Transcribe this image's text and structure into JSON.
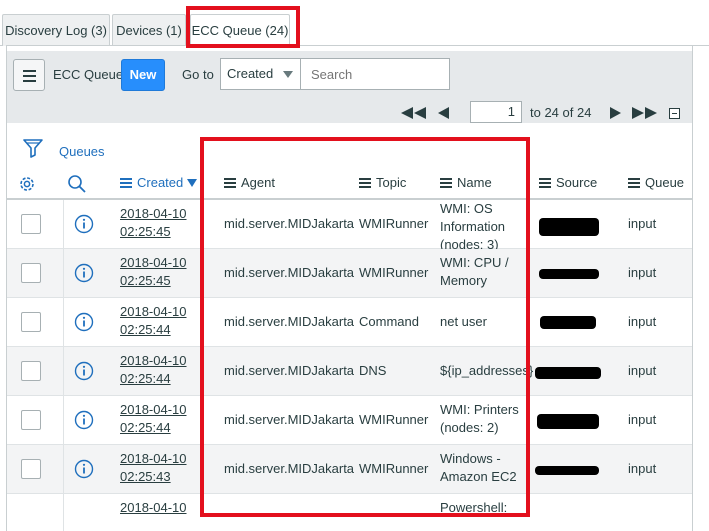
{
  "tabs": [
    {
      "label": "Discovery Log (3)"
    },
    {
      "label": "Devices (1)"
    },
    {
      "label": "ECC Queue (24)"
    }
  ],
  "toolbar": {
    "title": "ECC Queue",
    "new_label": "New",
    "goto_label": "Go to",
    "goto_select_value": "Created",
    "search_placeholder": "Search",
    "pager_current": "1",
    "pager_text": "to 24 of 24"
  },
  "filter": {
    "queues_label": "Queues"
  },
  "columns": {
    "created": "Created",
    "agent": "Agent",
    "topic": "Topic",
    "name": "Name",
    "source": "Source",
    "queue": "Queue"
  },
  "rows": [
    {
      "date": "2018-04-10",
      "time": "02:25:45",
      "agent": "mid.server.MIDJakarta",
      "topic": "WMIRunner",
      "name": "WMI: OS Information (nodes: 3)",
      "queue": "input"
    },
    {
      "date": "2018-04-10",
      "time": "02:25:45",
      "agent": "mid.server.MIDJakarta",
      "topic": "WMIRunner",
      "name": "WMI: CPU / Memory",
      "queue": "input"
    },
    {
      "date": "2018-04-10",
      "time": "02:25:44",
      "agent": "mid.server.MIDJakarta",
      "topic": "Command",
      "name": "net user",
      "queue": "input"
    },
    {
      "date": "2018-04-10",
      "time": "02:25:44",
      "agent": "mid.server.MIDJakarta",
      "topic": "DNS",
      "name": "${ip_addresses}",
      "queue": "input"
    },
    {
      "date": "2018-04-10",
      "time": "02:25:44",
      "agent": "mid.server.MIDJakarta",
      "topic": "WMIRunner",
      "name": "WMI: Printers (nodes: 2)",
      "queue": "input"
    },
    {
      "date": "2018-04-10",
      "time": "02:25:43",
      "agent": "mid.server.MIDJakarta",
      "topic": "WMIRunner",
      "name": "Windows - Amazon EC2",
      "queue": "input"
    },
    {
      "date": "2018-04-10",
      "time": "",
      "agent": "",
      "topic": "",
      "name": "Powershell:",
      "queue": ""
    }
  ],
  "colors": {
    "accent_blue": "#278efc",
    "link_blue": "#1f6fbd",
    "highlight_red": "#e3101d"
  }
}
